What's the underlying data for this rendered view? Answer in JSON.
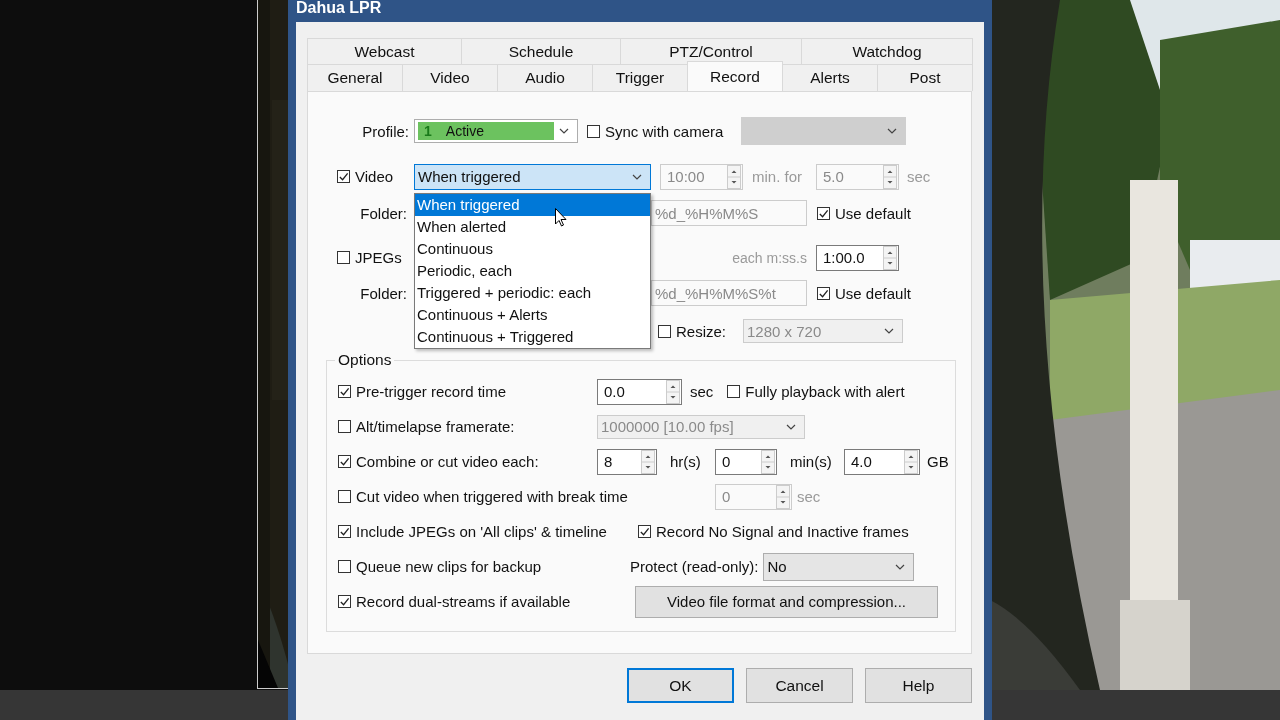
{
  "window": {
    "title": "Dahua LPR"
  },
  "tab_rows": [
    {
      "tabs": [
        {
          "label": "Webcast",
          "selected": false
        },
        {
          "label": "Schedule",
          "selected": false
        },
        {
          "label": "PTZ/Control",
          "selected": false
        },
        {
          "label": "Watchdog",
          "selected": false
        }
      ]
    },
    {
      "tabs": [
        {
          "label": "General",
          "selected": false
        },
        {
          "label": "Video",
          "selected": false
        },
        {
          "label": "Audio",
          "selected": false
        },
        {
          "label": "Trigger",
          "selected": false
        },
        {
          "label": "Record",
          "selected": true
        },
        {
          "label": "Alerts",
          "selected": false
        },
        {
          "label": "Post",
          "selected": false
        }
      ]
    }
  ],
  "profile": {
    "label": "Profile:",
    "badge": "1",
    "value": "Active",
    "color": "#6cc25f"
  },
  "sync_with_camera": {
    "label": "Sync with camera",
    "checked": false
  },
  "video": {
    "label": "Video",
    "checked": true,
    "mode": "When triggered",
    "mode_list": {
      "expanded": true,
      "options": [
        {
          "label": "When triggered",
          "selected": true
        },
        {
          "label": "When alerted",
          "selected": false
        },
        {
          "label": "Continuous",
          "selected": false
        },
        {
          "label": "Periodic, each",
          "selected": false
        },
        {
          "label": "Triggered + periodic: each",
          "selected": false
        },
        {
          "label": "Continuous + Alerts",
          "selected": false
        },
        {
          "label": "Continuous + Triggered",
          "selected": false
        }
      ]
    },
    "interval": {
      "value": "10:00",
      "disabled": true
    },
    "interval_unit": "min. for",
    "duration": {
      "value": "5.0",
      "disabled": true
    },
    "duration_unit": "sec",
    "folder_label": "Folder:",
    "folder": "%d_%H%M%S",
    "use_default": {
      "label": "Use default",
      "checked": true
    }
  },
  "jpegs": {
    "label": "JPEGs",
    "checked": false,
    "interval_label": "each m:ss.s",
    "interval": {
      "value": "1:00.0",
      "disabled": false
    },
    "folder_label": "Folder:",
    "folder": "%d_%H%M%S%t",
    "use_default": {
      "label": "Use default",
      "checked": true
    },
    "resize": {
      "label": "Resize:",
      "checked": false,
      "value": "1280 x 720",
      "disabled": true
    }
  },
  "options": {
    "title": "Options",
    "pre_trigger": {
      "label": "Pre-trigger record time",
      "checked": true,
      "value": "0.0",
      "unit": "sec"
    },
    "fully_playback": {
      "label": "Fully playback with alert",
      "checked": false
    },
    "alt_framerate": {
      "label": "Alt/timelapse framerate:",
      "checked": false,
      "value": "1000000 [10.00 fps]",
      "disabled": true
    },
    "combine": {
      "label": "Combine or cut video each:",
      "checked": true,
      "hours": "8",
      "hours_unit": "hr(s)",
      "minutes": "0",
      "minutes_unit": "min(s)",
      "size": "4.0",
      "size_unit": "GB"
    },
    "cut_on_trigger": {
      "label": "Cut video when triggered with break time",
      "checked": false,
      "value": "0",
      "unit": "sec",
      "disabled": true
    },
    "include_jpegs": {
      "label": "Include JPEGs on 'All clips' & timeline",
      "checked": true
    },
    "record_no_signal": {
      "label": "Record No Signal and Inactive frames",
      "checked": true
    },
    "queue_backup": {
      "label": "Queue new clips for backup",
      "checked": false
    },
    "protect": {
      "label": "Protect (read-only):",
      "value": "No"
    },
    "dual_streams": {
      "label": "Record dual-streams if available",
      "checked": true
    },
    "format_button": "Video file format and compression..."
  },
  "buttons": [
    {
      "label": "OK",
      "focused": true
    },
    {
      "label": "Cancel",
      "focused": false
    },
    {
      "label": "Help",
      "focused": false
    }
  ]
}
